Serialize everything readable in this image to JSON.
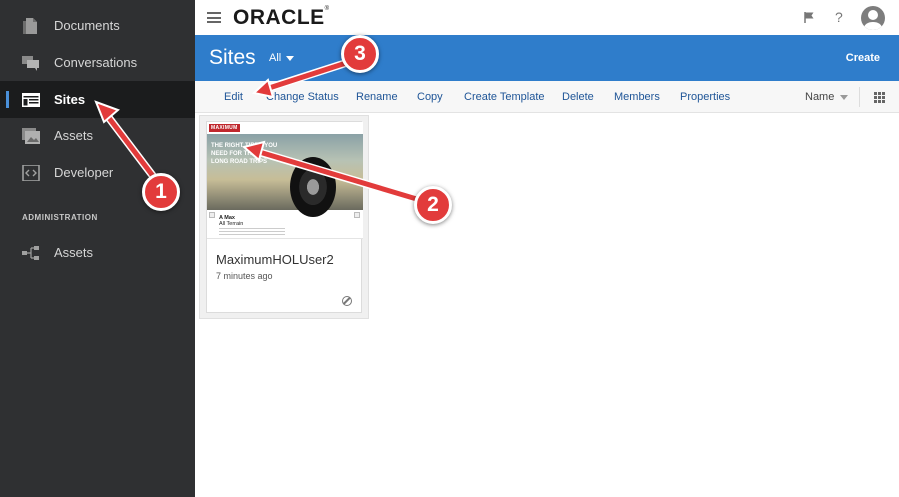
{
  "sidebar": {
    "items": [
      {
        "label": "Documents",
        "icon": "documents-icon"
      },
      {
        "label": "Conversations",
        "icon": "conversations-icon"
      },
      {
        "label": "Sites",
        "icon": "sites-icon",
        "active": true
      },
      {
        "label": "Assets",
        "icon": "assets-icon"
      },
      {
        "label": "Developer",
        "icon": "developer-icon"
      }
    ],
    "admin_section": "ADMINISTRATION",
    "admin_items": [
      {
        "label": "Assets",
        "icon": "admin-assets-icon"
      }
    ]
  },
  "topbar": {
    "logo": "ORACLE",
    "logo_mark": "®",
    "flag_icon": "flag-icon",
    "help": "?",
    "avatar_icon": "user-avatar-icon"
  },
  "header": {
    "title": "Sites",
    "filter": "All",
    "create": "Create"
  },
  "toolbar": {
    "actions": [
      "Edit",
      "Change Status",
      "Rename",
      "Copy",
      "Create Template",
      "Delete",
      "Members",
      "Properties"
    ],
    "sort": "Name",
    "view_icon": "grid-view-icon"
  },
  "site_card": {
    "name": "MaximumHOLUser2",
    "time": "7 minutes ago",
    "thumbnail": {
      "brand": "MAXIMUM",
      "headline": "THE RIGHT TIRES YOU NEED FOR THOSE LONG ROAD TRIPS",
      "product": "A Max",
      "product_sub": "All Terrain"
    },
    "status_icon": "unpublished-status-icon"
  },
  "annotations": [
    "1",
    "2",
    "3"
  ],
  "colors": {
    "sidebar_bg": "#2f3032",
    "header_blue": "#2f7dcb",
    "link_blue": "#1f5597",
    "annotation_red": "#e23b3b"
  }
}
